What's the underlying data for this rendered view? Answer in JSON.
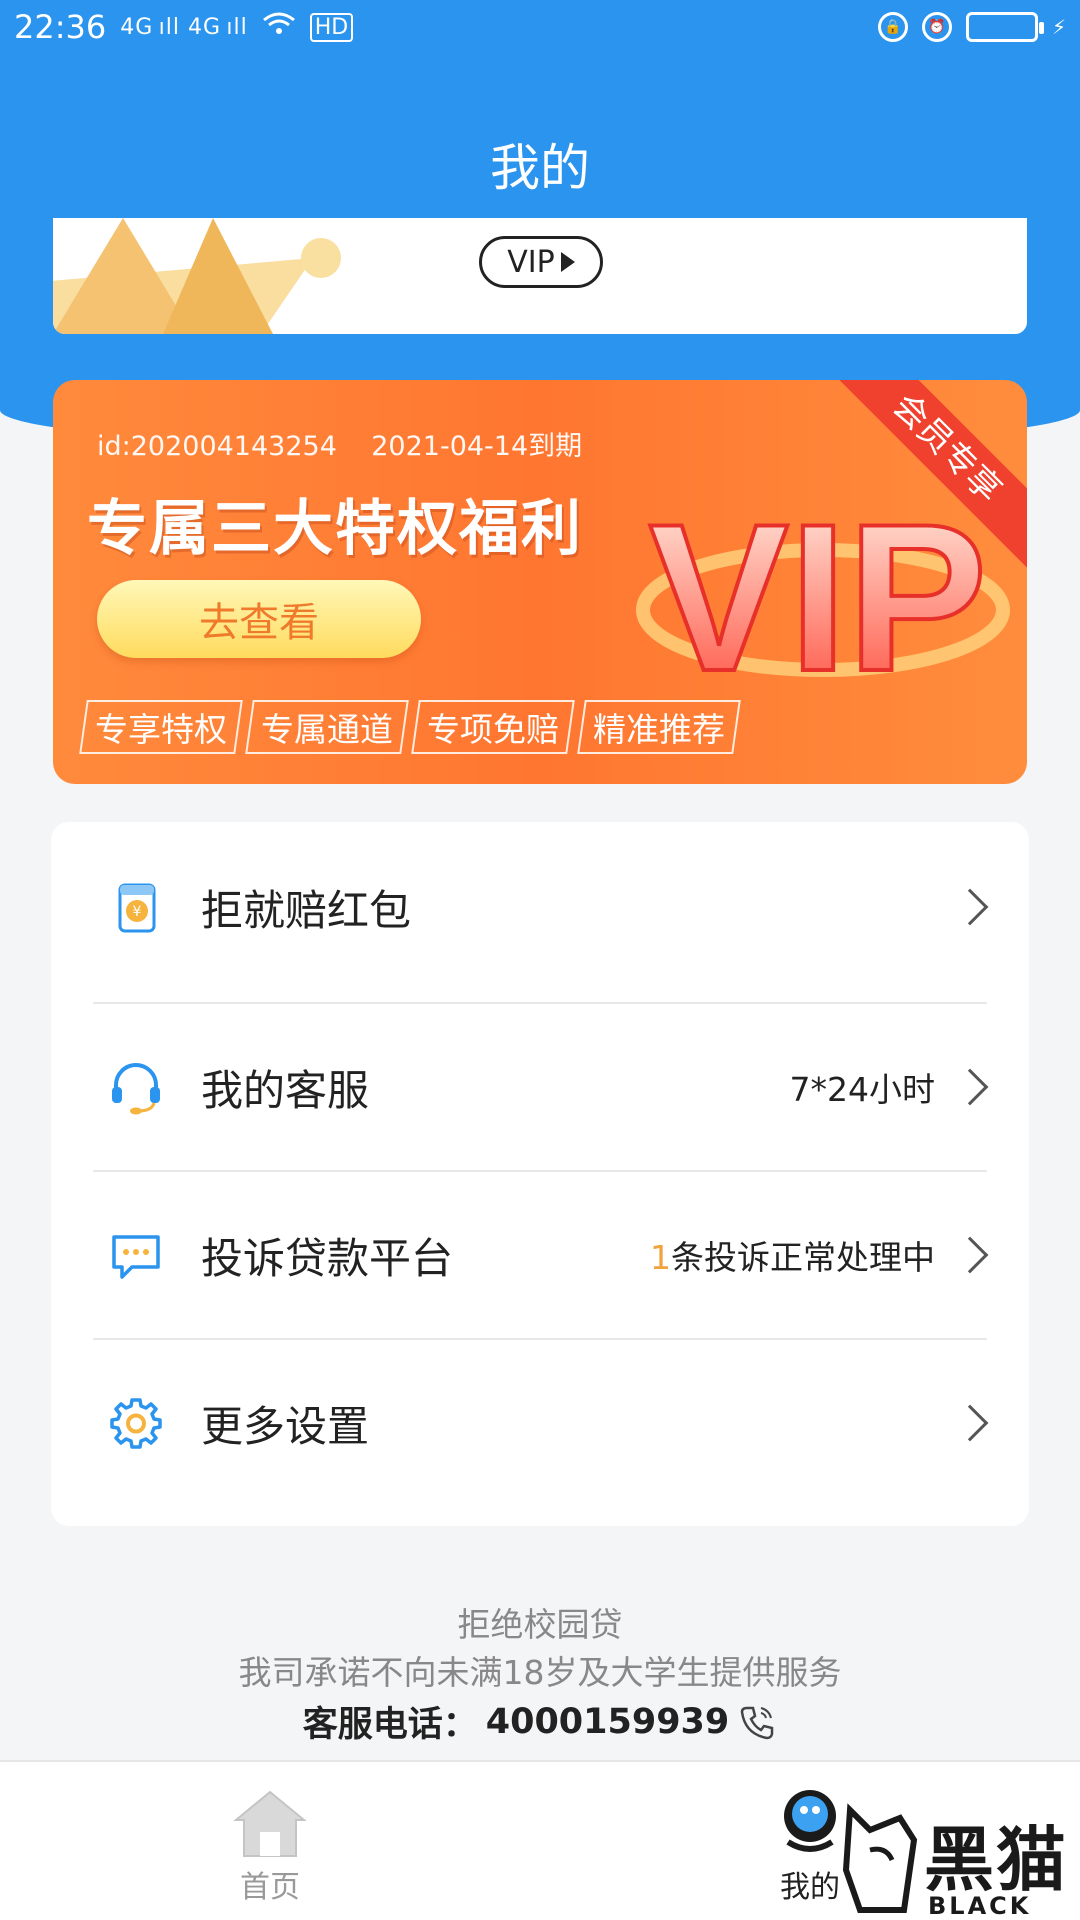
{
  "status_bar": {
    "time": "22:36",
    "signal_text": "4G ıll 4G ıll",
    "hd_badge": "HD"
  },
  "header": {
    "title": "我的"
  },
  "vip_card": {
    "pill_label": "VIP"
  },
  "banner": {
    "id_text": "id:202004143254",
    "expiry_text": "2021-04-14到期",
    "title": "专属三大特权福利",
    "cta_label": "去查看",
    "tags": [
      "专享特权",
      "专属通道",
      "专项免赔",
      "精准推荐"
    ],
    "ribbon": "会员专享",
    "art_text": "VIP",
    "colors": {
      "bg": "#ff7a32",
      "ribbon": "#f0412e",
      "cta_text": "#f07a2c"
    }
  },
  "menu": {
    "items": [
      {
        "label": "拒就赔红包",
        "right": "",
        "icon": "red-envelope-icon"
      },
      {
        "label": "我的客服",
        "right": "7*24小时",
        "icon": "headset-icon"
      },
      {
        "label": "投诉贷款平台",
        "right_num": "1",
        "right": "条投诉正常处理中",
        "icon": "chat-bubble-icon"
      },
      {
        "label": "更多设置",
        "right": "",
        "icon": "gear-icon"
      }
    ]
  },
  "footer": {
    "line1": "拒绝校园贷",
    "line2": "我司承诺不向未满18岁及大学生提供服务",
    "phone_label": "客服电话：",
    "phone_number": "4000159939"
  },
  "tabbar": {
    "home_label": "首页",
    "mine_label": "我的"
  },
  "watermark": {
    "big": "黑猫",
    "small": "BLACK CAT"
  },
  "colors": {
    "primary_blue": "#2a94ee",
    "accent_orange": "#f2a23a"
  }
}
